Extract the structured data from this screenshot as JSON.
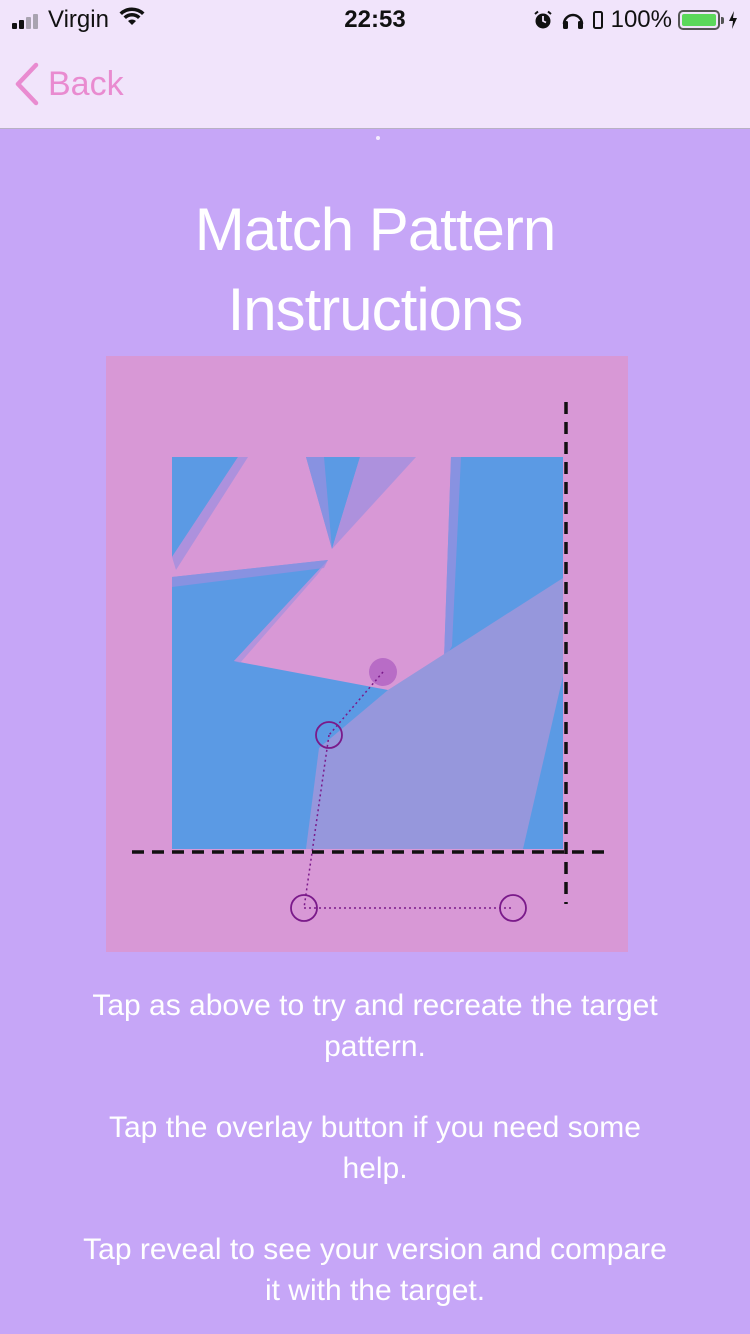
{
  "status_bar": {
    "carrier": "Virgin",
    "time": "22:53",
    "battery_percent": "100%",
    "battery_level": 1.0,
    "icons": [
      "signal-icon",
      "wifi-icon",
      "alarm-icon",
      "headphones-icon",
      "battery-icon",
      "charging-icon"
    ]
  },
  "nav": {
    "back_label": "Back",
    "accent_color": "#e98bd0"
  },
  "page": {
    "title_line1": "Match Pattern",
    "title_line2": "Instructions"
  },
  "instructions": [
    "Tap as above to try and recreate the target pattern.",
    "Tap the overlay button if you need some help.",
    "Tap reveal to see your version and compare it with the target."
  ],
  "colors": {
    "background": "#c6a6f7",
    "nav_background": "#f1e4fb",
    "canvas_pink": "#d898d6",
    "pattern_blue": "#5b9ae4",
    "overlay_lavender": "#9697dc",
    "tap_marker": "#7a1a8a"
  }
}
